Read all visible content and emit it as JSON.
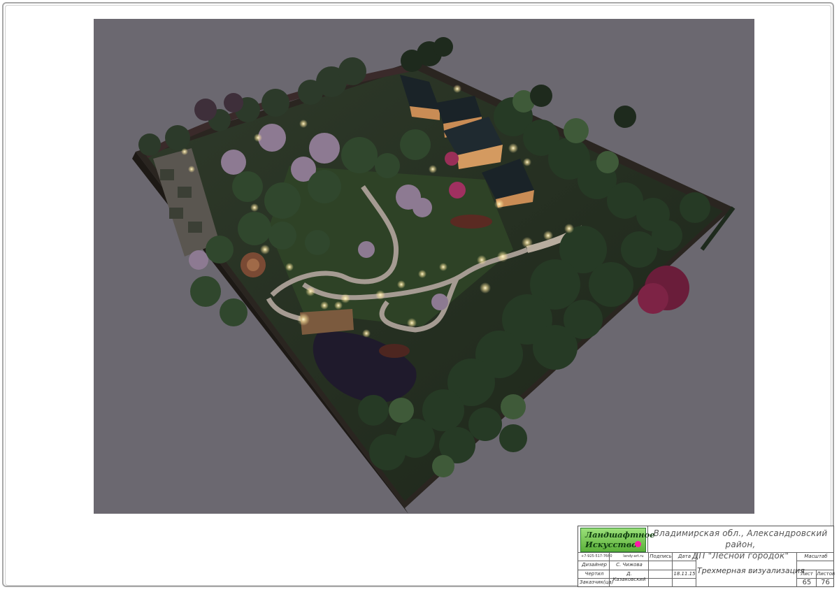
{
  "drawing": {
    "logo": {
      "line1": "Ландшафтное",
      "line2": "Искусство"
    },
    "phone": "+7-925-517-7660",
    "website": "landy-art.ru",
    "address_line1": "Владимирская обл., Александровский район,",
    "address_line2": "ДП \"Лесной городок\"",
    "header_signature": "Подпись",
    "header_date": "Дата",
    "header_scale": "Масштаб",
    "designer_role": "Дизайнер",
    "designer_name": "С. Чижова",
    "drafter_role": "Чертил",
    "drafter_name": "Д. Казаковский",
    "date": "18.11.15",
    "client_role": "Заказчик(ца)",
    "sheet_title": "Трехмерная визуализация",
    "sheet_label": "Лист",
    "sheets_label": "Листов",
    "sheet_number": "65",
    "sheet_total": "76"
  },
  "colors": {
    "render_background": "#6b6870",
    "frame": "#a8a8a8",
    "logo_green": "#5cb13a",
    "logo_dot": "#ff1aa8"
  }
}
